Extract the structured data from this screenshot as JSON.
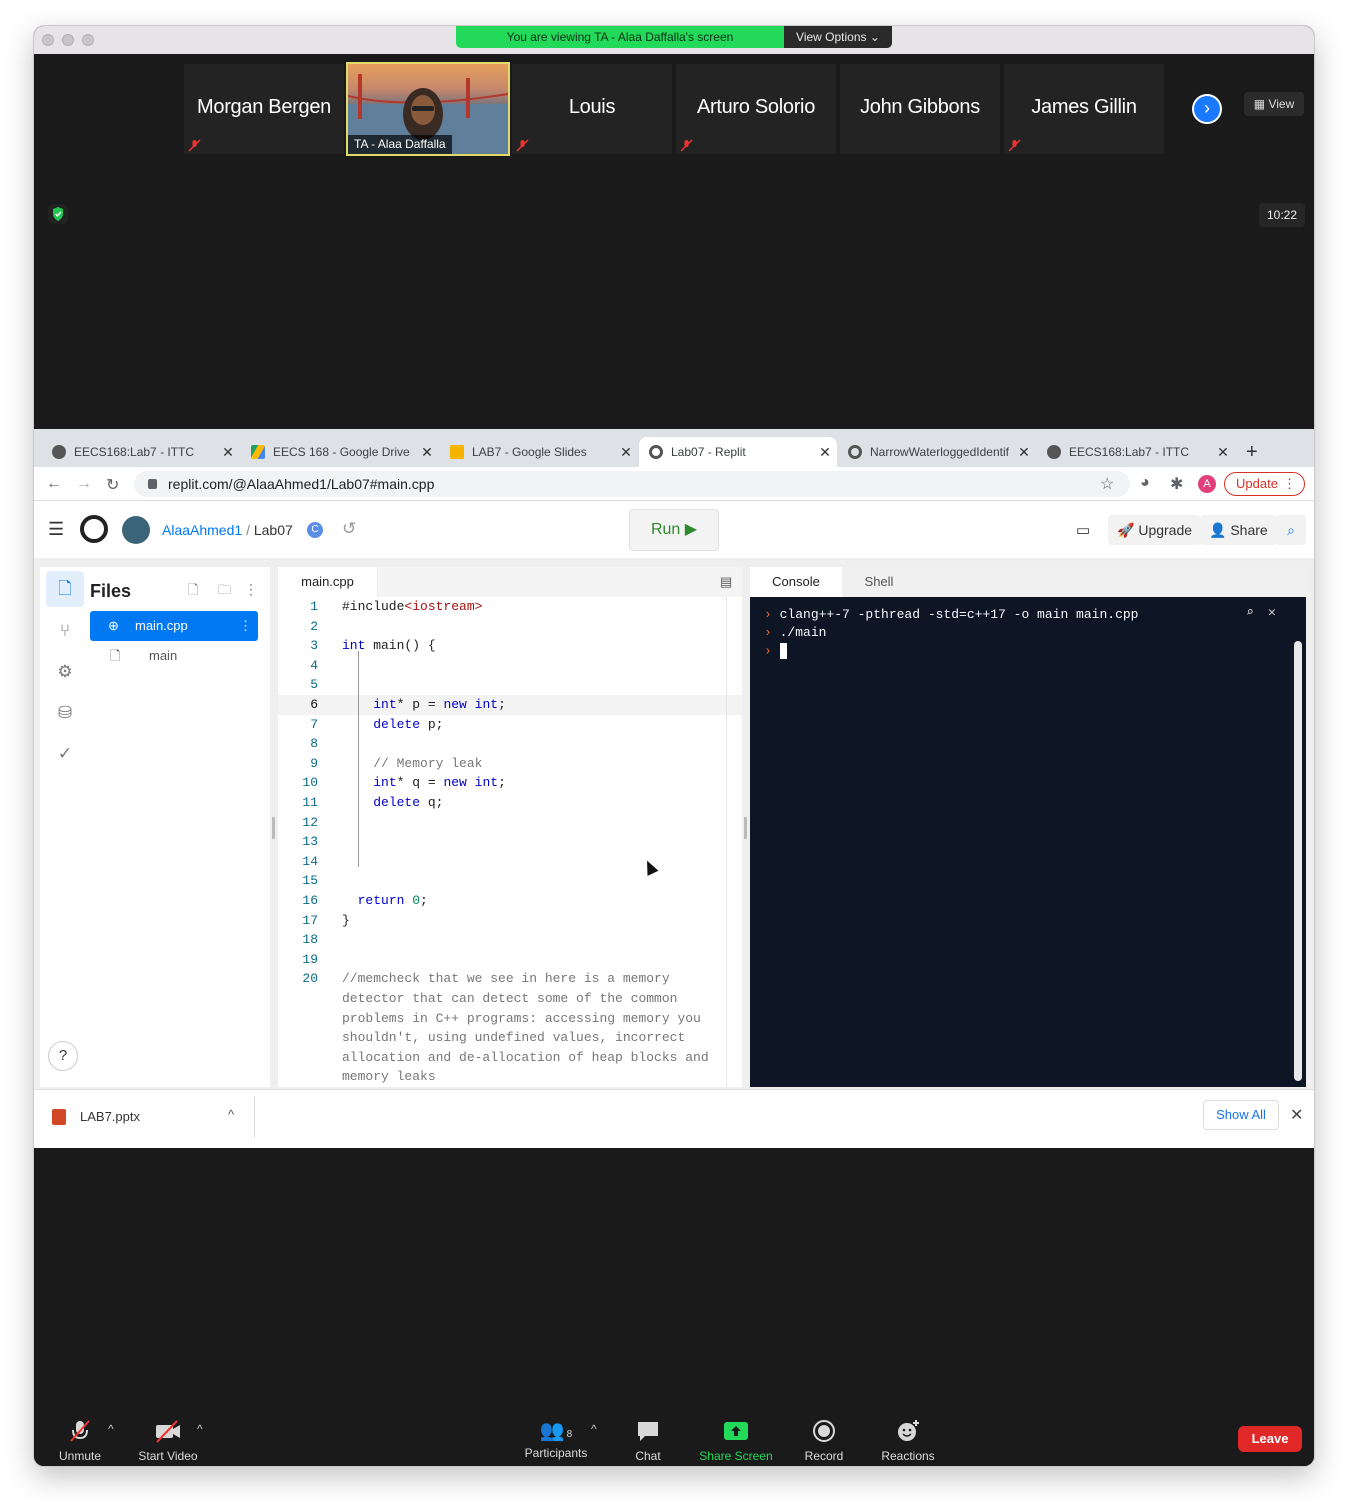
{
  "zoom": {
    "banner": "You are viewing TA - Alaa Daffalla's screen",
    "view_options": "View Options",
    "view_button": "View",
    "participants_tiles": [
      {
        "name": "Morgan Bergen",
        "muted": true
      },
      {
        "name": "TA - Alaa Daffalla",
        "muted": false,
        "video": true
      },
      {
        "name": "Louis",
        "muted": true
      },
      {
        "name": "Arturo Solorio",
        "muted": true
      },
      {
        "name": "John Gibbons",
        "muted": false
      },
      {
        "name": "James Gillin",
        "muted": true
      }
    ],
    "time": "10:22",
    "toolbar": {
      "unmute": "Unmute",
      "start_video": "Start Video",
      "participants": "Participants",
      "participants_count": "8",
      "chat": "Chat",
      "share_screen": "Share Screen",
      "record": "Record",
      "reactions": "Reactions",
      "leave": "Leave"
    }
  },
  "browser": {
    "tabs": [
      {
        "title": "EECS168:Lab7 - ITTC",
        "icon": "globe-icon"
      },
      {
        "title": "EECS 168 - Google Drive",
        "icon": "drive-icon"
      },
      {
        "title": "LAB7 - Google Slides",
        "icon": "slides-icon"
      },
      {
        "title": "Lab07 - Replit",
        "icon": "replit-icon",
        "active": true
      },
      {
        "title": "NarrowWaterloggedIdentif",
        "icon": "replit-icon"
      },
      {
        "title": "EECS168:Lab7 - ITTC",
        "icon": "globe-icon"
      }
    ],
    "url": "replit.com/@AlaaAhmed1/Lab07#main.cpp",
    "profile_initial": "A",
    "update_label": "Update"
  },
  "replit": {
    "user": "AlaaAhmed1",
    "separator": "/",
    "repl": "Lab07",
    "run_label": "Run",
    "upgrade": "Upgrade",
    "share": "Share",
    "files_title": "Files",
    "files": [
      "main.cpp",
      "main"
    ],
    "editor_tab": "main.cpp",
    "console_tab": "Console",
    "shell_tab": "Shell",
    "help": "?",
    "code_lines": [
      {
        "n": "1",
        "t": "#include<iostream>"
      },
      {
        "n": "2",
        "t": ""
      },
      {
        "n": "3",
        "t": "int main() {"
      },
      {
        "n": "4",
        "t": ""
      },
      {
        "n": "5",
        "t": ""
      },
      {
        "n": "6",
        "t": "    int* p = new int;"
      },
      {
        "n": "7",
        "t": "    delete p;"
      },
      {
        "n": "8",
        "t": ""
      },
      {
        "n": "9",
        "t": "    // Memory leak"
      },
      {
        "n": "10",
        "t": "    int* q = new int;"
      },
      {
        "n": "11",
        "t": "    delete q;"
      },
      {
        "n": "12",
        "t": ""
      },
      {
        "n": "13",
        "t": ""
      },
      {
        "n": "14",
        "t": ""
      },
      {
        "n": "15",
        "t": ""
      },
      {
        "n": "16",
        "t": "  return 0;"
      },
      {
        "n": "17",
        "t": "}"
      },
      {
        "n": "18",
        "t": ""
      },
      {
        "n": "19",
        "t": ""
      },
      {
        "n": "20",
        "t": "//memcheck that we see in here is a memory"
      }
    ],
    "comment_wrap": [
      "detector that can detect some of the common",
      "problems in C++ programs: accessing memory you",
      "shouldn't, using undefined values, incorrect",
      "allocation and de-allocation of heap blocks and",
      "memory leaks"
    ],
    "console_lines": [
      "clang++-7 -pthread -std=c++17 -o main main.cpp",
      "./main"
    ]
  },
  "downloads": {
    "file": "LAB7.pptx",
    "show_all": "Show All"
  },
  "colors": {
    "zoom_green": "#23d959",
    "leave_red": "#e02828",
    "replit_blue": "#0079f2",
    "terminal_bg": "#0e1525"
  }
}
